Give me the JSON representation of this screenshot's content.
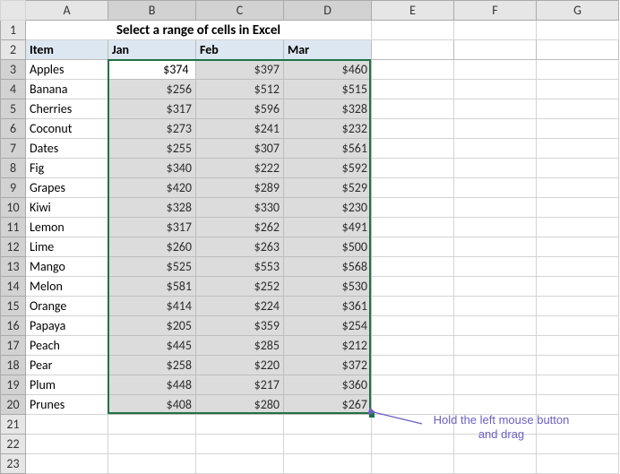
{
  "columns": [
    "A",
    "B",
    "C",
    "D",
    "E",
    "F",
    "G"
  ],
  "title": "Select a range of cells in Excel",
  "headers": {
    "item": "Item",
    "jan": "Jan",
    "feb": "Feb",
    "mar": "Mar"
  },
  "rows": [
    {
      "item": "Apples",
      "jan": "$374",
      "feb": "$397",
      "mar": "$460"
    },
    {
      "item": "Banana",
      "jan": "$256",
      "feb": "$512",
      "mar": "$515"
    },
    {
      "item": "Cherries",
      "jan": "$317",
      "feb": "$596",
      "mar": "$328"
    },
    {
      "item": "Coconut",
      "jan": "$273",
      "feb": "$241",
      "mar": "$232"
    },
    {
      "item": "Dates",
      "jan": "$255",
      "feb": "$307",
      "mar": "$561"
    },
    {
      "item": "Fig",
      "jan": "$340",
      "feb": "$222",
      "mar": "$592"
    },
    {
      "item": "Grapes",
      "jan": "$420",
      "feb": "$289",
      "mar": "$529"
    },
    {
      "item": "Kiwi",
      "jan": "$328",
      "feb": "$330",
      "mar": "$230"
    },
    {
      "item": "Lemon",
      "jan": "$317",
      "feb": "$262",
      "mar": "$491"
    },
    {
      "item": "Lime",
      "jan": "$260",
      "feb": "$263",
      "mar": "$500"
    },
    {
      "item": "Mango",
      "jan": "$525",
      "feb": "$553",
      "mar": "$568"
    },
    {
      "item": "Melon",
      "jan": "$581",
      "feb": "$252",
      "mar": "$530"
    },
    {
      "item": "Orange",
      "jan": "$414",
      "feb": "$224",
      "mar": "$361"
    },
    {
      "item": "Papaya",
      "jan": "$205",
      "feb": "$359",
      "mar": "$254"
    },
    {
      "item": "Peach",
      "jan": "$445",
      "feb": "$285",
      "mar": "$212"
    },
    {
      "item": "Pear",
      "jan": "$258",
      "feb": "$220",
      "mar": "$372"
    },
    {
      "item": "Plum",
      "jan": "$448",
      "feb": "$217",
      "mar": "$360"
    },
    {
      "item": "Prunes",
      "jan": "$408",
      "feb": "$280",
      "mar": "$267"
    }
  ],
  "callout": "Hold the left mouse button\nand drag",
  "chart_data": {
    "type": "table",
    "title": "Select a range of cells in Excel",
    "categories": [
      "Jan",
      "Feb",
      "Mar"
    ],
    "series": [
      {
        "name": "Apples",
        "values": [
          374,
          397,
          460
        ]
      },
      {
        "name": "Banana",
        "values": [
          256,
          512,
          515
        ]
      },
      {
        "name": "Cherries",
        "values": [
          317,
          596,
          328
        ]
      },
      {
        "name": "Coconut",
        "values": [
          273,
          241,
          232
        ]
      },
      {
        "name": "Dates",
        "values": [
          255,
          307,
          561
        ]
      },
      {
        "name": "Fig",
        "values": [
          340,
          222,
          592
        ]
      },
      {
        "name": "Grapes",
        "values": [
          420,
          289,
          529
        ]
      },
      {
        "name": "Kiwi",
        "values": [
          328,
          330,
          230
        ]
      },
      {
        "name": "Lemon",
        "values": [
          317,
          262,
          491
        ]
      },
      {
        "name": "Lime",
        "values": [
          260,
          263,
          500
        ]
      },
      {
        "name": "Mango",
        "values": [
          525,
          553,
          568
        ]
      },
      {
        "name": "Melon",
        "values": [
          581,
          252,
          530
        ]
      },
      {
        "name": "Orange",
        "values": [
          414,
          224,
          361
        ]
      },
      {
        "name": "Papaya",
        "values": [
          205,
          359,
          254
        ]
      },
      {
        "name": "Peach",
        "values": [
          445,
          285,
          212
        ]
      },
      {
        "name": "Pear",
        "values": [
          258,
          220,
          372
        ]
      },
      {
        "name": "Plum",
        "values": [
          448,
          217,
          360
        ]
      },
      {
        "name": "Prunes",
        "values": [
          408,
          280,
          267
        ]
      }
    ]
  }
}
